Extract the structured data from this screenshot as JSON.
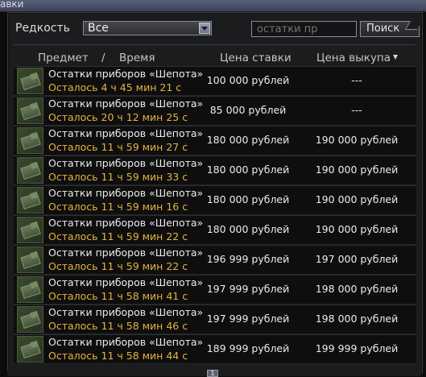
{
  "window": {
    "title": "авки"
  },
  "filter": {
    "rarity_label": "Редкость",
    "rarity_value": "Все",
    "search_placeholder": "остатки пр",
    "search_button": "Поиск"
  },
  "table": {
    "headers": {
      "item": "Предмет",
      "slash": "/",
      "time": "Время",
      "bid": "Цена ставки",
      "buyout": "Цена выкупа"
    },
    "rows": [
      {
        "name": "Остатки приборов «Шепота»",
        "time_left": "Осталось 4 ч 45 мин 21 с",
        "bid": "100 000 рублей",
        "buyout": "---"
      },
      {
        "name": "Остатки приборов «Шепота»",
        "time_left": "Осталось 20 ч 12 мин 25 с",
        "bid": "85 000 рублей",
        "buyout": "---"
      },
      {
        "name": "Остатки приборов «Шепота»",
        "time_left": "Осталось 11 ч 59 мин 27 с",
        "bid": "180 000 рублей",
        "buyout": "190 000 рублей"
      },
      {
        "name": "Остатки приборов «Шепота»",
        "time_left": "Осталось 11 ч 59 мин 33 с",
        "bid": "180 000 рублей",
        "buyout": "190 000 рублей"
      },
      {
        "name": "Остатки приборов «Шепота»",
        "time_left": "Осталось 11 ч 59 мин 16 с",
        "bid": "180 000 рублей",
        "buyout": "190 000 рублей"
      },
      {
        "name": "Остатки приборов «Шепота»",
        "time_left": "Осталось 11 ч 59 мин 22 с",
        "bid": "180 000 рублей",
        "buyout": "190 000 рублей"
      },
      {
        "name": "Остатки приборов «Шепота»",
        "time_left": "Осталось 11 ч 59 мин 22 с",
        "bid": "196 999 рублей",
        "buyout": "197 000 рублей"
      },
      {
        "name": "Остатки приборов «Шепота»",
        "time_left": "Осталось 11 ч 58 мин 41 с",
        "bid": "197 999 рублей",
        "buyout": "198 000 рублей"
      },
      {
        "name": "Остатки приборов «Шепота»",
        "time_left": "Осталось 11 ч 58 мин 46 с",
        "bid": "197 999 рублей",
        "buyout": "198 000 рублей"
      },
      {
        "name": "Остатки приборов «Шепота»",
        "time_left": "Осталось 11 ч 58 мин 44 с",
        "bid": "189 999 рублей",
        "buyout": "199 999 рублей"
      }
    ]
  },
  "pagination": {
    "current_page": "1"
  },
  "colors": {
    "time_left": "#e3b53a",
    "background": "#1b1c1e"
  }
}
